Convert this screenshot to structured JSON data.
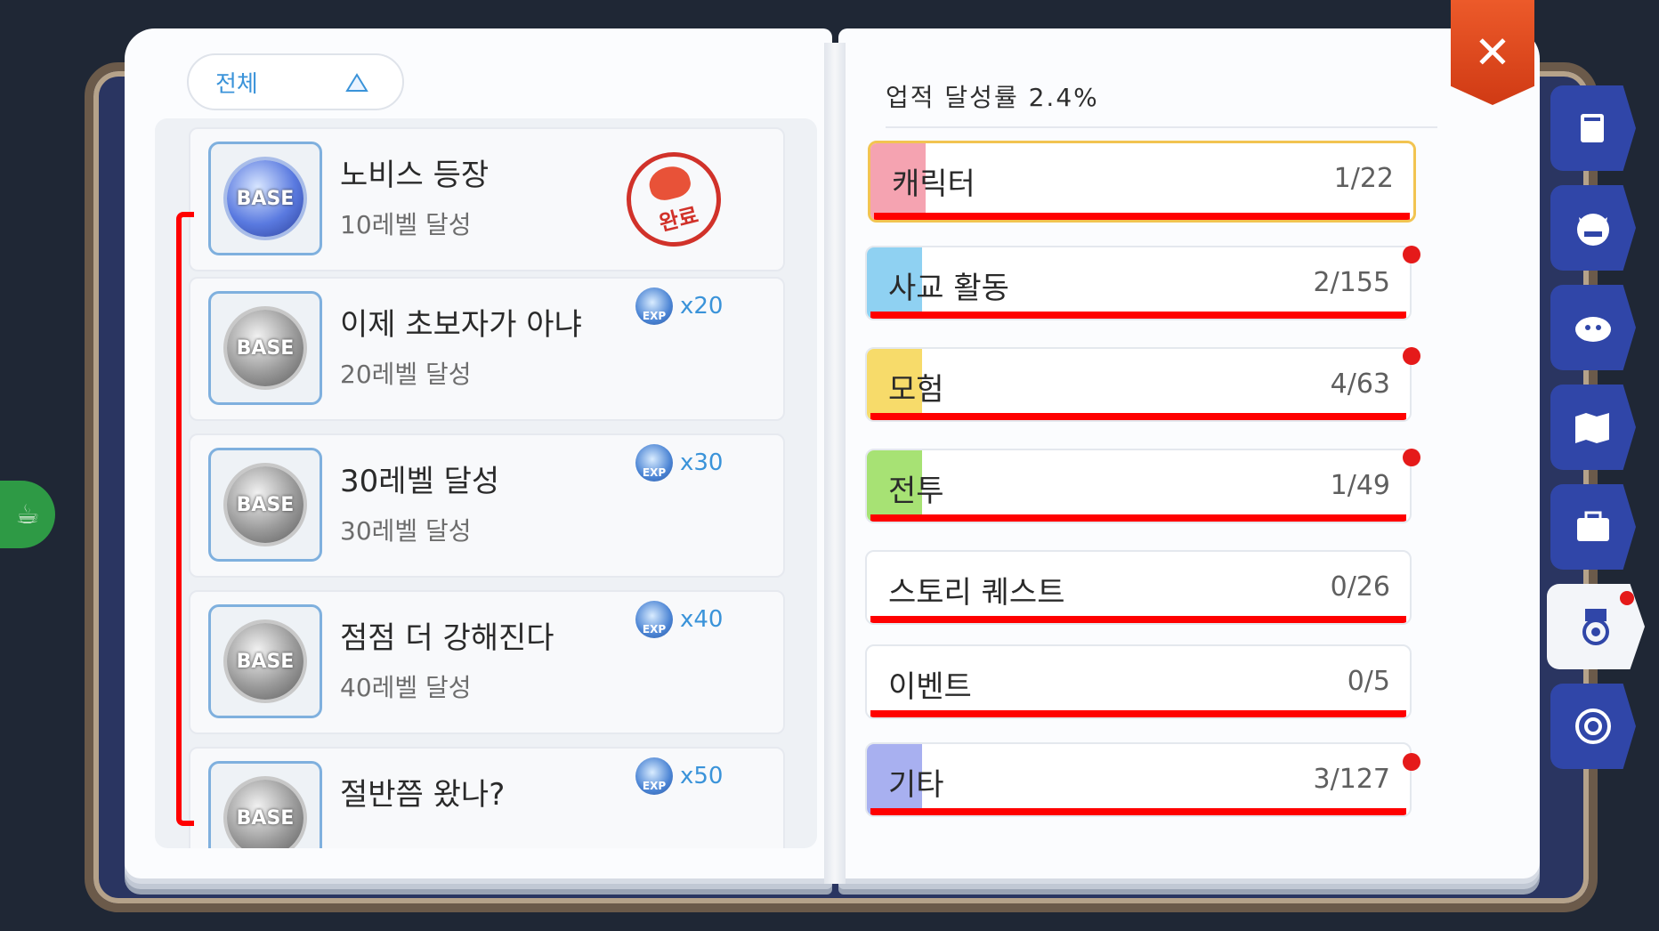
{
  "filter": {
    "label": "전체"
  },
  "achievements": [
    {
      "title": "노비스 등장",
      "desc": "10레벨 달성",
      "badge": "BASE",
      "completed": true,
      "stamp": "완료"
    },
    {
      "title": "이제 초보자가 아냐",
      "desc": "20레벨 달성",
      "badge": "BASE",
      "reward_icon": "EXP",
      "reward": "x20"
    },
    {
      "title": "30레벨 달성",
      "desc": "30레벨 달성",
      "badge": "BASE",
      "reward_icon": "EXP",
      "reward": "x30"
    },
    {
      "title": "점점 더 강해진다",
      "desc": "40레벨 달성",
      "badge": "BASE",
      "reward_icon": "EXP",
      "reward": "x40"
    },
    {
      "title": "절반쯤 왔나?",
      "badge": "BASE",
      "reward_icon": "EXP",
      "reward": "x50"
    }
  ],
  "progress_text": "업적 달성률 2.4%",
  "categories": [
    {
      "name": "캐릭터",
      "count": "1/22",
      "color": "#f5a3b1",
      "selected": true,
      "dot": false
    },
    {
      "name": "사교 활동",
      "count": "2/155",
      "color": "#8fd1f2",
      "dot": true
    },
    {
      "name": "모험",
      "count": "4/63",
      "color": "#f7db6a",
      "dot": true
    },
    {
      "name": "전투",
      "count": "1/49",
      "color": "#a7e274",
      "dot": true
    },
    {
      "name": "스토리 퀘스트",
      "count": "0/26",
      "color": "#ffffff",
      "dot": false
    },
    {
      "name": "이벤트",
      "count": "0/5",
      "color": "#ffffff",
      "dot": false
    },
    {
      "name": "기타",
      "count": "3/127",
      "color": "#a8b0f0",
      "dot": true
    }
  ],
  "close_label": "✕",
  "side_tabs": [
    "book-icon",
    "cat-mask-icon",
    "monster-icon",
    "map-icon",
    "briefcase-icon",
    "medal-icon",
    "target-icon"
  ],
  "colors": {
    "accent": "#3a93d9",
    "alert": "#e51a1a",
    "tab": "#3046a8",
    "close": "#d03a14"
  }
}
